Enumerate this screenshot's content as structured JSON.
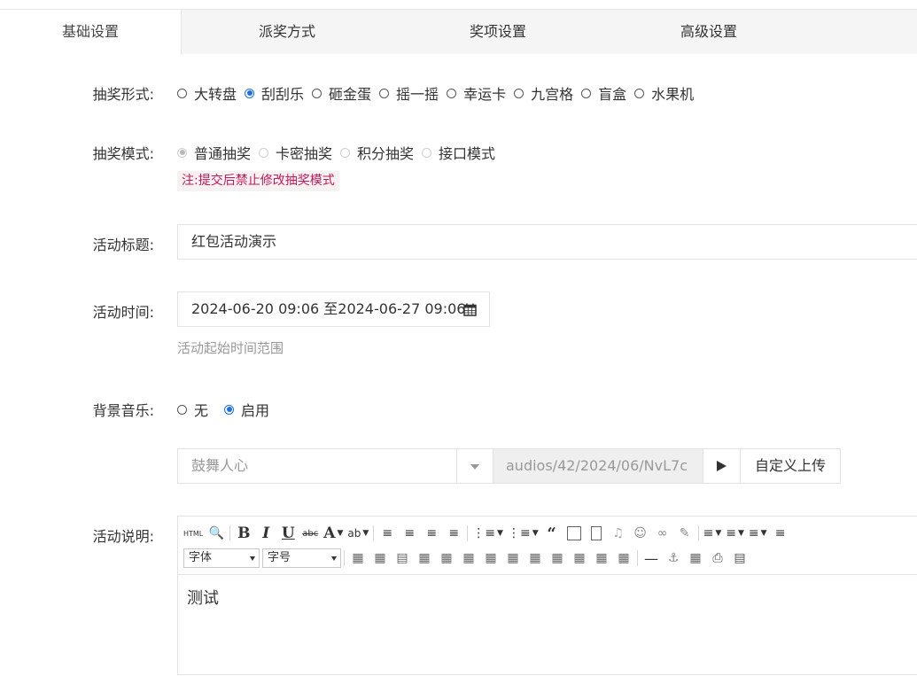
{
  "tabs": [
    {
      "label": "基础设置",
      "active": true
    },
    {
      "label": "派奖方式",
      "active": false
    },
    {
      "label": "奖项设置",
      "active": false
    },
    {
      "label": "高级设置",
      "active": false
    }
  ],
  "lottery_form": {
    "label": "抽奖形式:",
    "options": [
      "大转盘",
      "刮刮乐",
      "砸金蛋",
      "摇一摇",
      "幸运卡",
      "九宫格",
      "盲盒",
      "水果机"
    ],
    "selected": "刮刮乐"
  },
  "lottery_mode": {
    "label": "抽奖模式:",
    "options": [
      "普通抽奖",
      "卡密抽奖",
      "积分抽奖",
      "接口模式"
    ],
    "selected": "普通抽奖",
    "note": "注:提交后禁止修改抽奖模式"
  },
  "title_field": {
    "label": "活动标题:",
    "value": "红包活动演示"
  },
  "time_field": {
    "label": "活动时间:",
    "value": "2024-06-20 09:06 至2024-06-27 09:06",
    "help": "活动起始时间范围"
  },
  "music": {
    "label": "背景音乐:",
    "options": [
      "无",
      "启用"
    ],
    "selected": "启用",
    "track": "鼓舞人心",
    "path": "audios/42/2024/06/NvL7c",
    "upload_label": "自定义上传"
  },
  "description": {
    "label": "活动说明:",
    "font_family_select": "字体",
    "font_size_select": "字号",
    "content": "测试",
    "html_label": "HTML"
  },
  "colors": {
    "accent": "#1e6fe0",
    "note_text": "#c2185b",
    "note_bg": "#f7f2f2",
    "tab_bar": "#f5f5f5"
  }
}
